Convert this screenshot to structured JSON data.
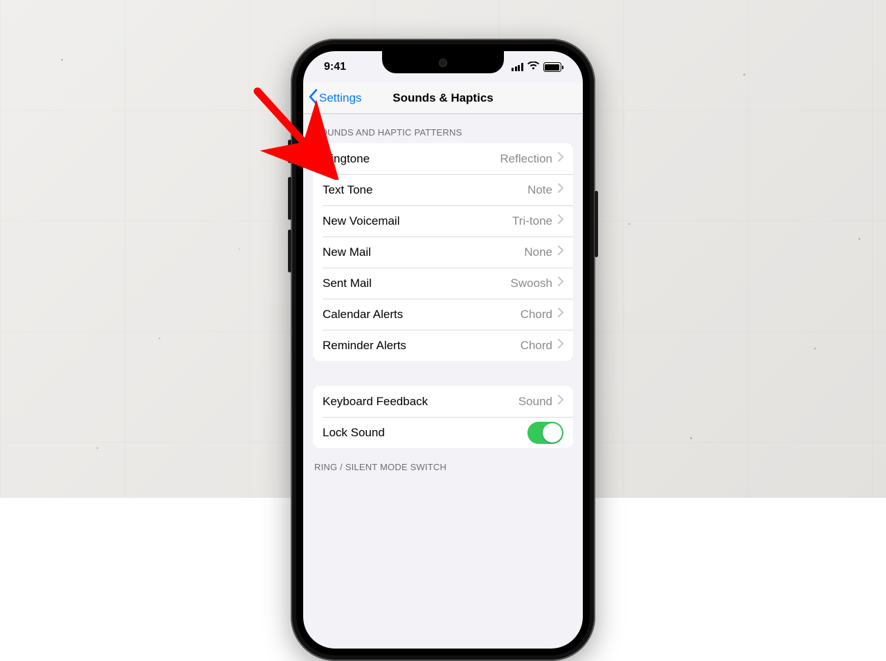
{
  "status": {
    "time": "9:41"
  },
  "nav": {
    "back_label": "Settings",
    "title": "Sounds & Haptics"
  },
  "section1": {
    "header": "Sounds and Haptic Patterns",
    "rows": [
      {
        "label": "Ringtone",
        "value": "Reflection"
      },
      {
        "label": "Text Tone",
        "value": "Note"
      },
      {
        "label": "New Voicemail",
        "value": "Tri-tone"
      },
      {
        "label": "New Mail",
        "value": "None"
      },
      {
        "label": "Sent Mail",
        "value": "Swoosh"
      },
      {
        "label": "Calendar Alerts",
        "value": "Chord"
      },
      {
        "label": "Reminder Alerts",
        "value": "Chord"
      }
    ]
  },
  "section2": {
    "rows": [
      {
        "label": "Keyboard Feedback",
        "value": "Sound",
        "type": "disclosure"
      },
      {
        "label": "Lock Sound",
        "type": "toggle",
        "on": true
      }
    ]
  },
  "section3": {
    "header": "Ring / Silent Mode Switch"
  },
  "colors": {
    "accent": "#007aff",
    "toggle_on": "#34c759",
    "annotation": "#ff0000"
  }
}
